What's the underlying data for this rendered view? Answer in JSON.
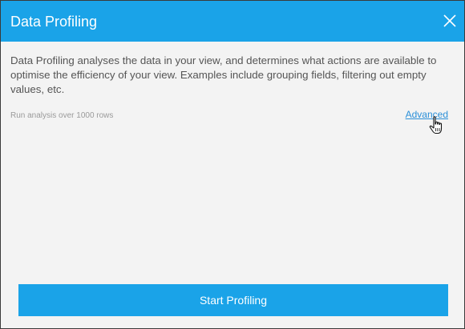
{
  "dialog": {
    "title": "Data Profiling",
    "close_icon": "close-icon",
    "description": "Data Profiling analyses the data in your view, and determines what actions are available to optimise the efficiency of your view. Examples include grouping fields, filtering out empty values, etc.",
    "row_note": "Run analysis over 1000 rows",
    "advanced_link": "Advanced",
    "start_button": "Start Profiling"
  },
  "colors": {
    "accent": "#1aa3e8",
    "body_background": "#f3f3f3",
    "link": "#2a8fd8"
  }
}
